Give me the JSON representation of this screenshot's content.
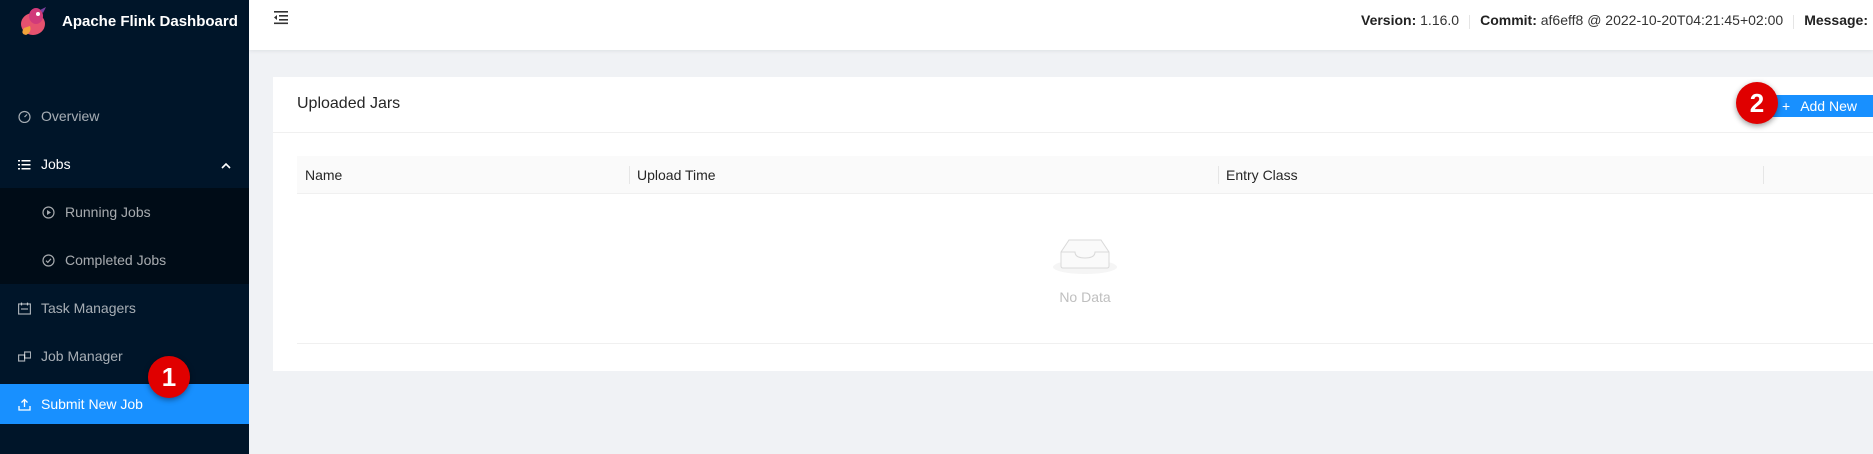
{
  "app": {
    "title": "Apache Flink Dashboard"
  },
  "sidebar": {
    "items": [
      {
        "label": "Overview",
        "icon": "dashboard-icon"
      },
      {
        "label": "Jobs",
        "icon": "list-icon",
        "expanded": true,
        "children": [
          {
            "label": "Running Jobs",
            "icon": "play-circle-icon"
          },
          {
            "label": "Completed Jobs",
            "icon": "check-circle-icon"
          }
        ]
      },
      {
        "label": "Task Managers",
        "icon": "schedule-icon"
      },
      {
        "label": "Job Manager",
        "icon": "build-icon"
      },
      {
        "label": "Submit New Job",
        "icon": "upload-icon",
        "active": true
      }
    ]
  },
  "header": {
    "version_label": "Version:",
    "version_value": "1.16.0",
    "commit_label": "Commit:",
    "commit_value": "af6eff8 @ 2022-10-20T04:21:45+02:00",
    "message_label": "Message:"
  },
  "card": {
    "title": "Uploaded Jars",
    "add_button_label": "Add New",
    "columns": [
      "Name",
      "Upload Time",
      "Entry Class",
      ""
    ],
    "empty_text": "No Data"
  },
  "markers": [
    "1",
    "2"
  ],
  "colors": {
    "sidebar_bg": "#001529",
    "accent": "#1890ff",
    "marker": "#e00000"
  }
}
